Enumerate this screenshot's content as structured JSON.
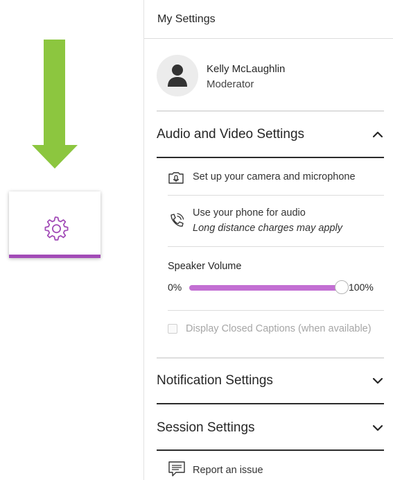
{
  "callout": {
    "arrow_label": "Settings",
    "arrow_color": "#8cc63f",
    "gear_icon": "gear-icon",
    "gear_color": "#a24bb7"
  },
  "panel": {
    "title": "My Settings",
    "profile": {
      "name": "Kelly McLaughlin",
      "role": "Moderator",
      "avatar_icon": "user-icon"
    },
    "audio_video": {
      "title": "Audio and Video Settings",
      "expanded": true,
      "camera_mic": {
        "label": "Set up your camera and microphone",
        "icon": "camera-microphone-icon"
      },
      "phone_audio": {
        "label": "Use your phone for audio",
        "note": "Long distance charges may apply",
        "icon": "phone-icon"
      },
      "speaker_volume": {
        "label": "Speaker Volume",
        "min_label": "0%",
        "max_label": "100%",
        "value_percent": 100,
        "fill_color": "#c36fd3"
      },
      "closed_captions": {
        "label": "Display Closed Captions (when available)",
        "checked": false,
        "enabled": false
      }
    },
    "notification": {
      "title": "Notification Settings",
      "expanded": false
    },
    "session": {
      "title": "Session Settings",
      "expanded": false
    },
    "report": {
      "label": "Report an issue",
      "icon": "report-issue-icon"
    }
  }
}
